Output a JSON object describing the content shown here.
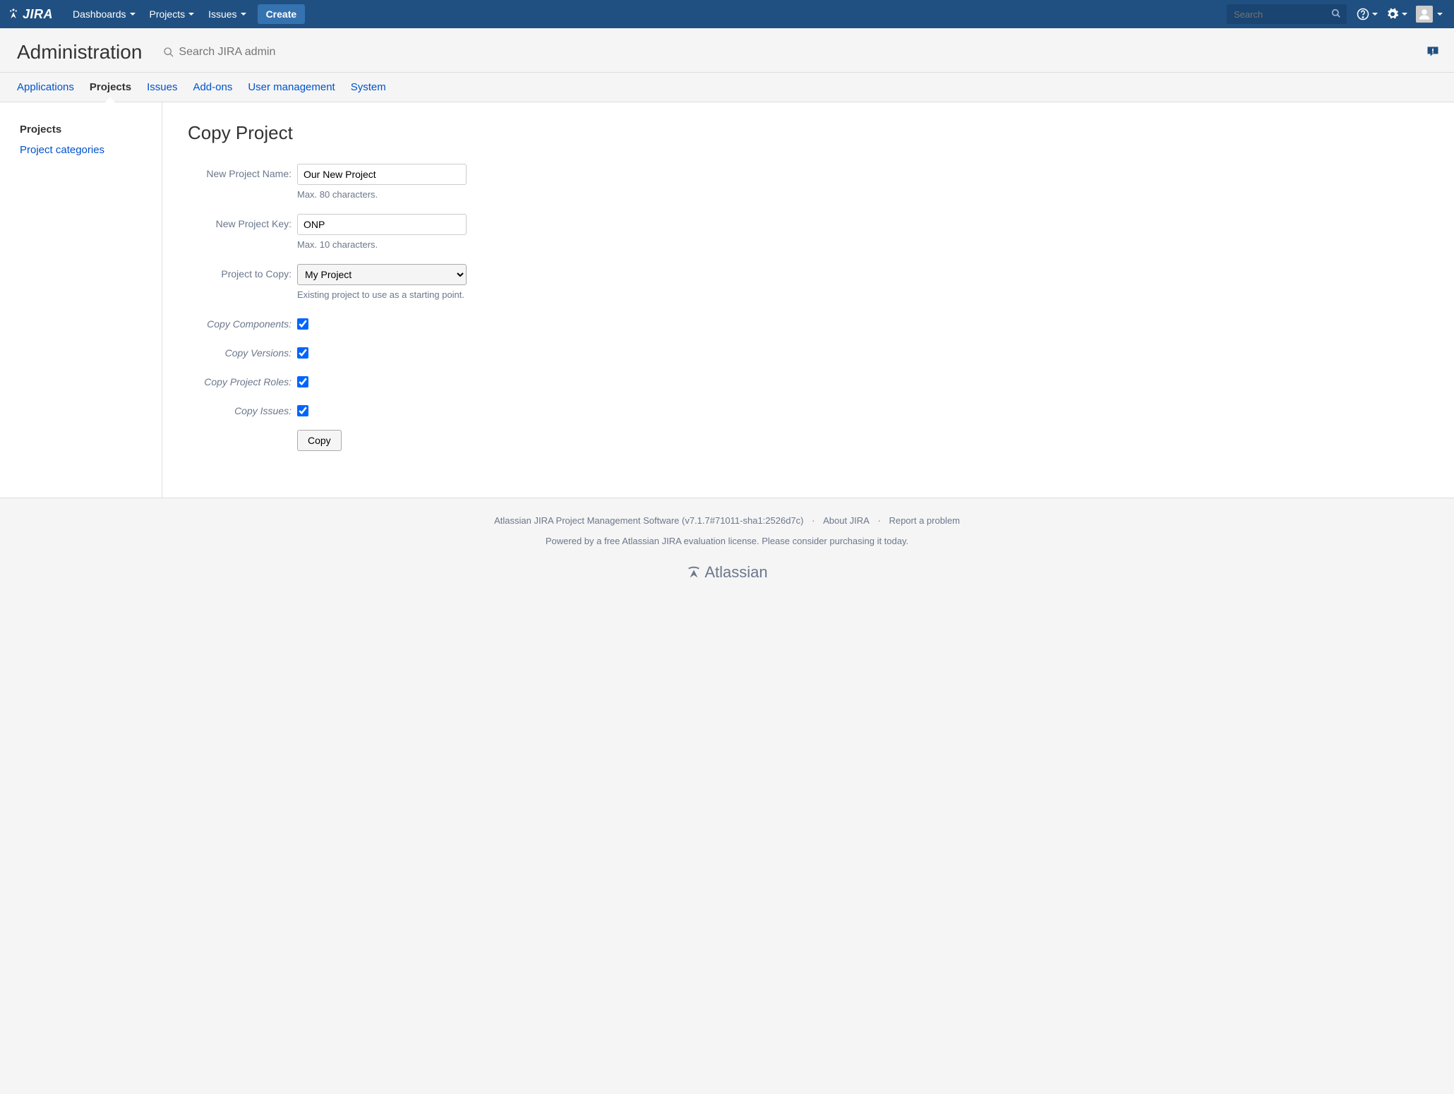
{
  "topnav": {
    "logo_text": "JIRA",
    "items": [
      "Dashboards",
      "Projects",
      "Issues"
    ],
    "create_label": "Create",
    "search_placeholder": "Search"
  },
  "admin_header": {
    "title": "Administration",
    "search_placeholder": "Search JIRA admin"
  },
  "tabs": [
    {
      "label": "Applications",
      "active": false
    },
    {
      "label": "Projects",
      "active": true
    },
    {
      "label": "Issues",
      "active": false
    },
    {
      "label": "Add-ons",
      "active": false
    },
    {
      "label": "User management",
      "active": false
    },
    {
      "label": "System",
      "active": false
    }
  ],
  "sidebar": {
    "items": [
      {
        "label": "Projects",
        "active": true
      },
      {
        "label": "Project categories",
        "active": false
      }
    ]
  },
  "page": {
    "title": "Copy Project",
    "form": {
      "name_label": "New Project Name:",
      "name_value": "Our New Project",
      "name_hint": "Max. 80 characters.",
      "key_label": "New Project Key:",
      "key_value": "ONP",
      "key_hint": "Max. 10 characters.",
      "project_label": "Project to Copy:",
      "project_value": "My Project",
      "project_hint": "Existing project to use as a starting point.",
      "copy_components_label": "Copy Components:",
      "copy_versions_label": "Copy Versions:",
      "copy_roles_label": "Copy Project Roles:",
      "copy_issues_label": "Copy Issues:",
      "submit_label": "Copy"
    }
  },
  "footer": {
    "software": "Atlassian JIRA Project Management Software (v7.1.7#71011-sha1:2526d7c)",
    "about": "About JIRA",
    "report": "Report a problem",
    "license": "Powered by a free Atlassian JIRA evaluation license. Please consider purchasing it today.",
    "atlassian": "Atlassian"
  }
}
